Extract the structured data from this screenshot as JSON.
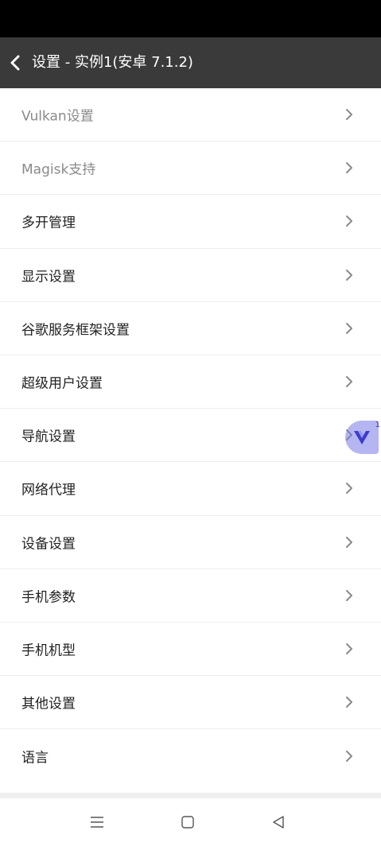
{
  "header": {
    "title": "设置 - 实例1(安卓 7.1.2)"
  },
  "settings": {
    "items": [
      {
        "label": "Vulkan设置",
        "enabled": false
      },
      {
        "label": "Magisk支持",
        "enabled": false
      },
      {
        "label": "多开管理",
        "enabled": true
      },
      {
        "label": "显示设置",
        "enabled": true
      },
      {
        "label": "谷歌服务框架设置",
        "enabled": true
      },
      {
        "label": "超级用户设置",
        "enabled": true
      },
      {
        "label": "导航设置",
        "enabled": true
      },
      {
        "label": "网络代理",
        "enabled": true
      },
      {
        "label": "设备设置",
        "enabled": true
      },
      {
        "label": "手机参数",
        "enabled": true
      },
      {
        "label": "手机机型",
        "enabled": true
      },
      {
        "label": "其他设置",
        "enabled": true
      },
      {
        "label": "语言",
        "enabled": true
      }
    ]
  },
  "floating_badge": {
    "count": "1",
    "icon": "v-logo-icon",
    "color": "#6a6ae0"
  },
  "colors": {
    "status_bar": "#000000",
    "app_bar": "#3a3a3a",
    "list_background": "#ffffff",
    "disabled_text": "#8a8a8a",
    "text": "#222222"
  },
  "nav_bar": {
    "icons": [
      "menu-icon",
      "home-square-icon",
      "back-triangle-icon"
    ]
  }
}
